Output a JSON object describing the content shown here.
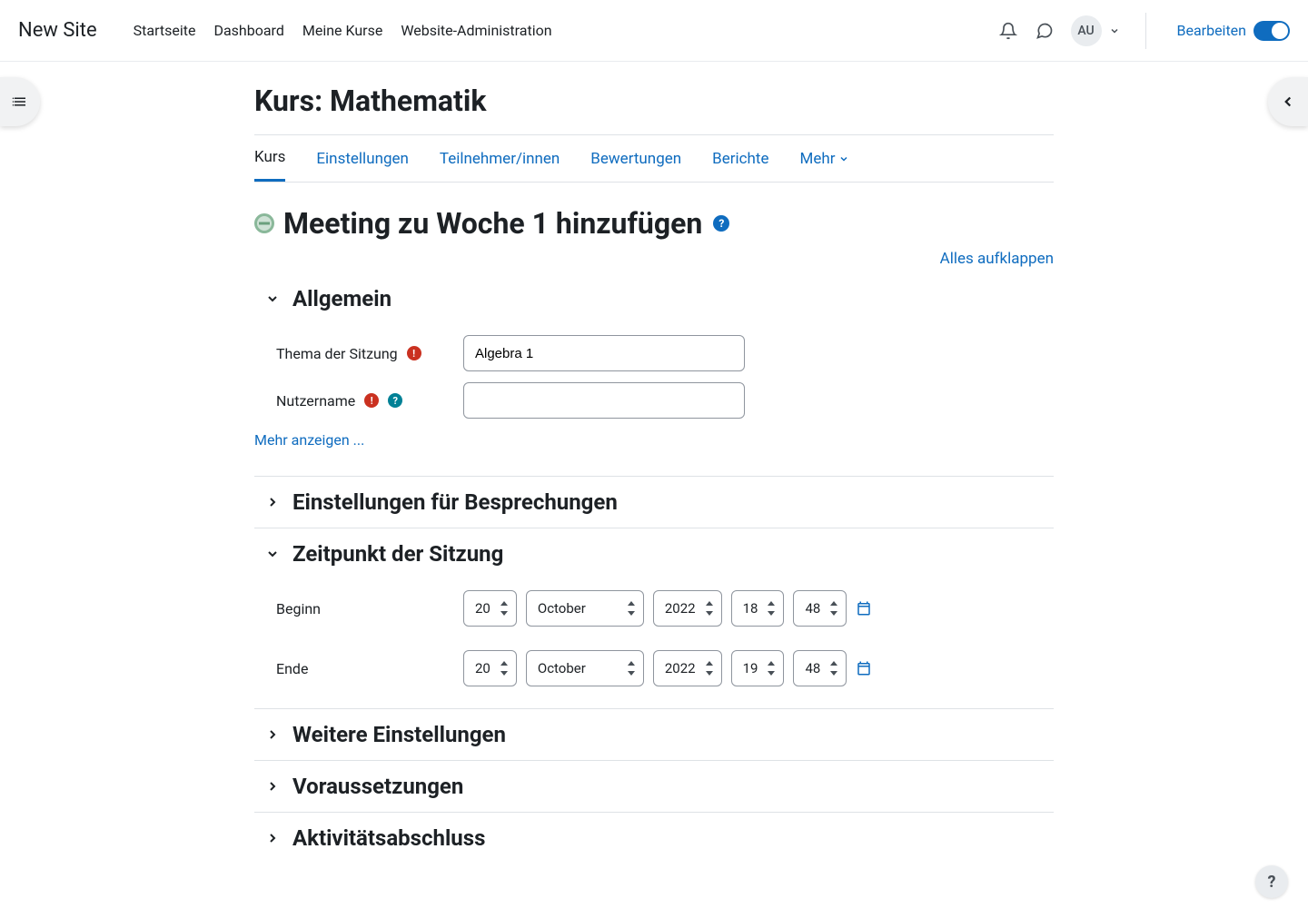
{
  "brand": "New Site",
  "nav": {
    "home": "Startseite",
    "dashboard": "Dashboard",
    "mycourses": "Meine Kurse",
    "admin": "Website-Administration"
  },
  "user": {
    "initials": "AU"
  },
  "editmode_label": "Bearbeiten",
  "page_title": "Kurs: Mathematik",
  "tabs": {
    "course": "Kurs",
    "settings": "Einstellungen",
    "participants": "Teilnehmer/innen",
    "grades": "Bewertungen",
    "reports": "Berichte",
    "more": "Mehr"
  },
  "activity_heading": "Meeting zu Woche 1 hinzufügen",
  "expand_all": "Alles aufklappen",
  "sections": {
    "general": "Allgemein",
    "meeting_settings": "Einstellungen für Besprechungen",
    "session_time": "Zeitpunkt der Sitzung",
    "more_settings": "Weitere Einstellungen",
    "restrictions": "Voraussetzungen",
    "completion": "Aktivitätsabschluss"
  },
  "fields": {
    "topic_label": "Thema der Sitzung",
    "topic_value": "Algebra 1",
    "username_label": "Nutzername",
    "username_value": "",
    "show_more": "Mehr anzeigen ...",
    "start_label": "Beginn",
    "end_label": "Ende"
  },
  "start": {
    "day": "20",
    "month": "October",
    "year": "2022",
    "hour": "18",
    "min": "48"
  },
  "end": {
    "day": "20",
    "month": "October",
    "year": "2022",
    "hour": "19",
    "min": "48"
  }
}
